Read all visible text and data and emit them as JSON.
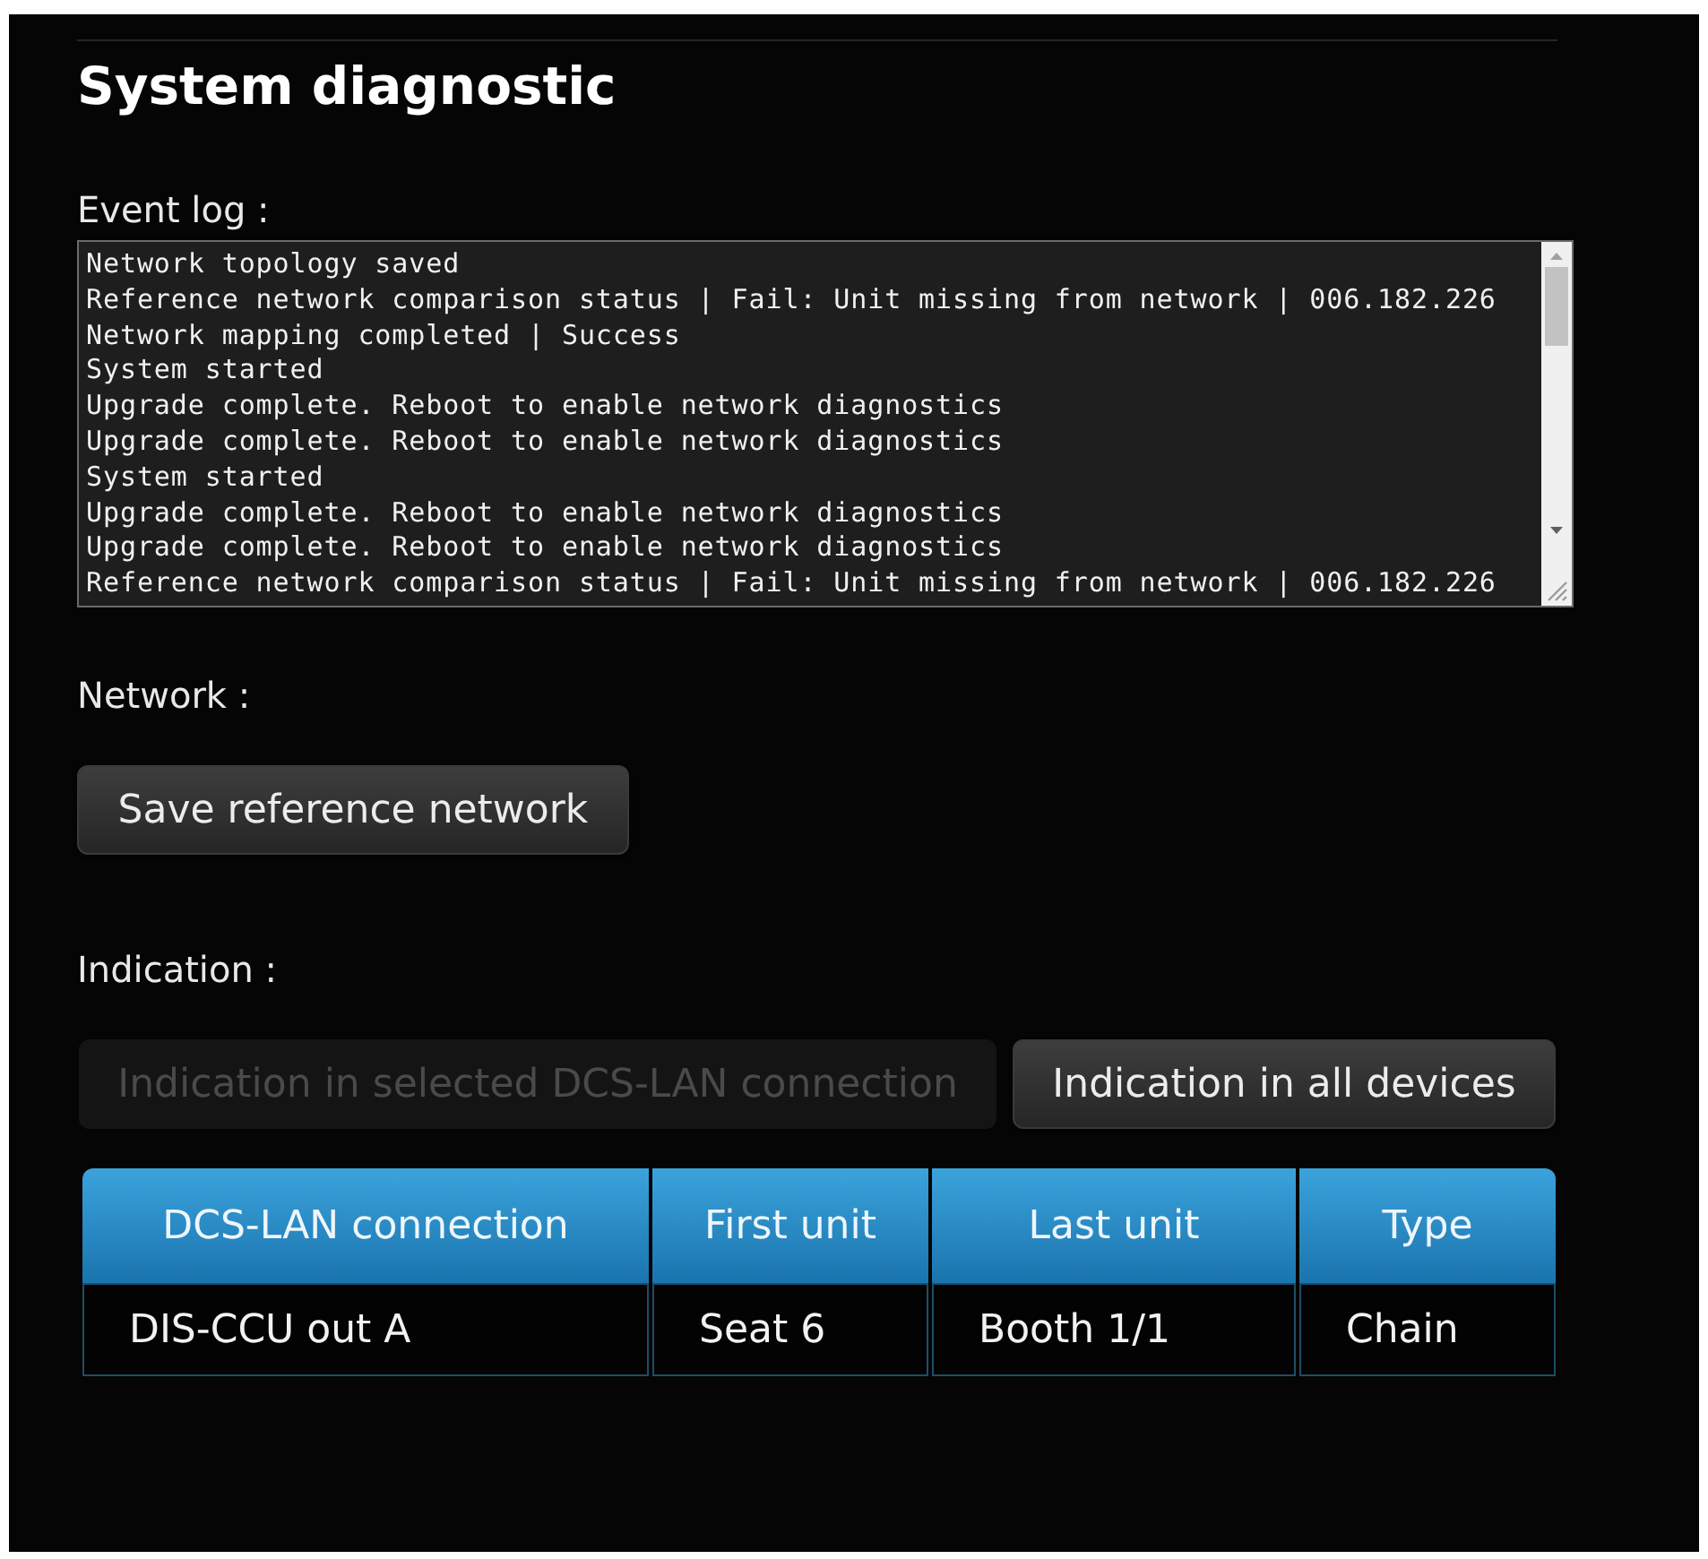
{
  "page": {
    "title": "System diagnostic"
  },
  "event_log": {
    "label": "Event log :",
    "lines": [
      "Network topology saved",
      "Reference network comparison status | Fail: Unit missing from network | 006.182.226",
      "Network mapping completed | Success",
      "System started",
      "Upgrade complete. Reboot to enable network diagnostics",
      "Upgrade complete. Reboot to enable network diagnostics",
      "System started",
      "Upgrade complete. Reboot to enable network diagnostics",
      "Upgrade complete. Reboot to enable network diagnostics",
      "Reference network comparison status | Fail: Unit missing from network | 006.182.226"
    ]
  },
  "network": {
    "label": "Network :",
    "buttons": [
      {
        "label": "Save reference network",
        "disabled": false
      }
    ]
  },
  "indication": {
    "label": "Indication :",
    "buttons": [
      {
        "label": "Indication in selected DCS-LAN connection",
        "disabled": true
      },
      {
        "label": "Indication in all devices",
        "disabled": false
      }
    ]
  },
  "table": {
    "columns": [
      "DCS-LAN connection",
      "First unit",
      "Last unit",
      "Type"
    ],
    "rows": [
      [
        "DIS-CCU out A",
        "Seat 6",
        "Booth 1/1",
        "Chain"
      ]
    ]
  }
}
